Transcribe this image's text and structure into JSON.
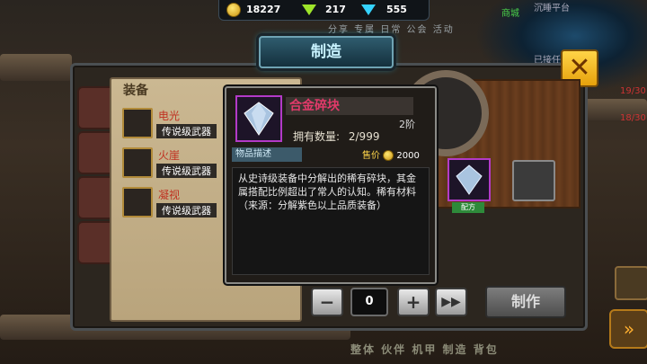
{
  "currency": {
    "gold": "18227",
    "green_gem": "217",
    "blue_gem": "555"
  },
  "top_menu": "分享 专属 日常 公会 活动",
  "right_labels": {
    "top": "沉睡平台",
    "mid": "已接任",
    "shop": "商城"
  },
  "title": "制造",
  "list": {
    "header": "装备",
    "items": [
      {
        "name": "电光",
        "type": "传说级武器"
      },
      {
        "name": "火崖",
        "type": "传说级武器"
      },
      {
        "name": "凝视",
        "type": "传说级武器"
      }
    ]
  },
  "tooltip": {
    "name": "合金碎块",
    "level": "2阶",
    "owned_label": "拥有数量:",
    "owned_value": "2/999",
    "desc_label": "物品描述",
    "price_label": "售价",
    "price": "2000",
    "description": "从史诗级装备中分解出的稀有碎块，其金属搭配比例超出了常人的认知。稀有材料（来源：分解紫色以上品质装备）"
  },
  "craft": {
    "slot_label": "配方",
    "quantity": "0",
    "make_label": "制作"
  },
  "bottom_nav": "整体 伙伴 机甲 制造 背包",
  "side_numbers": [
    "19/30",
    "18/30"
  ],
  "colors": {
    "accent": "#ffd447",
    "epic": "#b33ac7",
    "title_glow": "#2aa7c9"
  }
}
